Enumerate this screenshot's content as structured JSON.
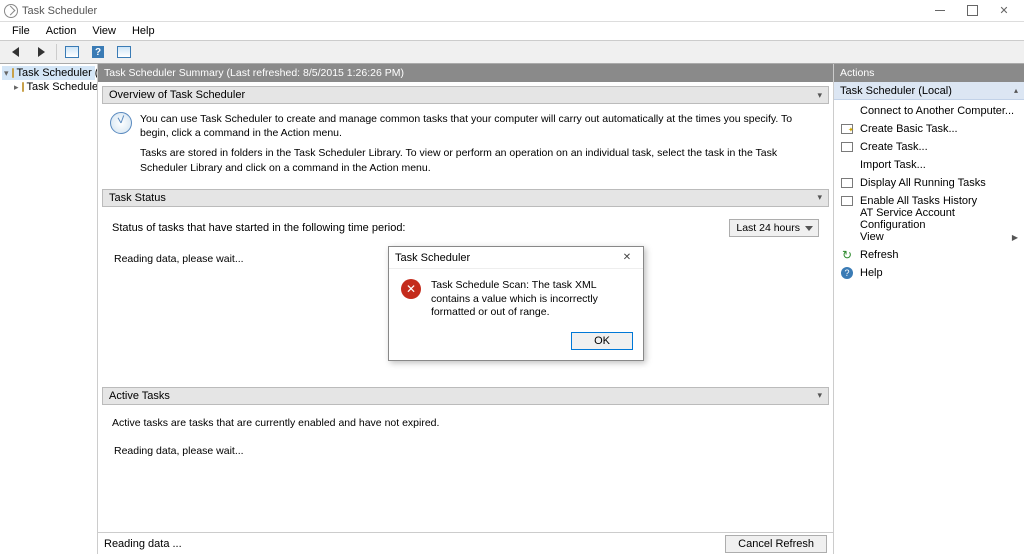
{
  "window": {
    "title": "Task Scheduler",
    "buttons": {
      "min": "Minimize",
      "max": "Maximize",
      "close": "Close"
    }
  },
  "menubar": [
    "File",
    "Action",
    "View",
    "Help"
  ],
  "tree": {
    "root": "Task Scheduler (Local)",
    "child": "Task Scheduler Library"
  },
  "summary": {
    "header": "Task Scheduler Summary (Last refreshed: 8/5/2015 1:26:26 PM)",
    "overview_title": "Overview of Task Scheduler",
    "overview_p1": "You can use Task Scheduler to create and manage common tasks that your computer will carry out automatically at the times you specify. To begin, click a command in the Action menu.",
    "overview_p2": "Tasks are stored in folders in the Task Scheduler Library. To view or perform an operation on an individual task, select the task in the Task Scheduler Library and click on a command in the Action menu.",
    "task_status_title": "Task Status",
    "status_label": "Status of tasks that have started in the following time period:",
    "dropdown": "Last 24 hours",
    "reading1": "Reading data, please wait...",
    "active_tasks_title": "Active Tasks",
    "active_desc": "Active tasks are tasks that are currently enabled and have not expired.",
    "reading2": "Reading data, please wait..."
  },
  "footer": {
    "status": "Reading data ...",
    "cancel": "Cancel Refresh"
  },
  "actions": {
    "title": "Actions",
    "group": "Task Scheduler (Local)",
    "items": [
      "Connect to Another Computer...",
      "Create Basic Task...",
      "Create Task...",
      "Import Task...",
      "Display All Running Tasks",
      "Enable All Tasks History",
      "AT Service Account Configuration",
      "View",
      "Refresh",
      "Help"
    ]
  },
  "dialog": {
    "title": "Task Scheduler",
    "message": "Task Schedule Scan: The task XML contains a value which is incorrectly formatted or out of range.",
    "ok": "OK"
  }
}
